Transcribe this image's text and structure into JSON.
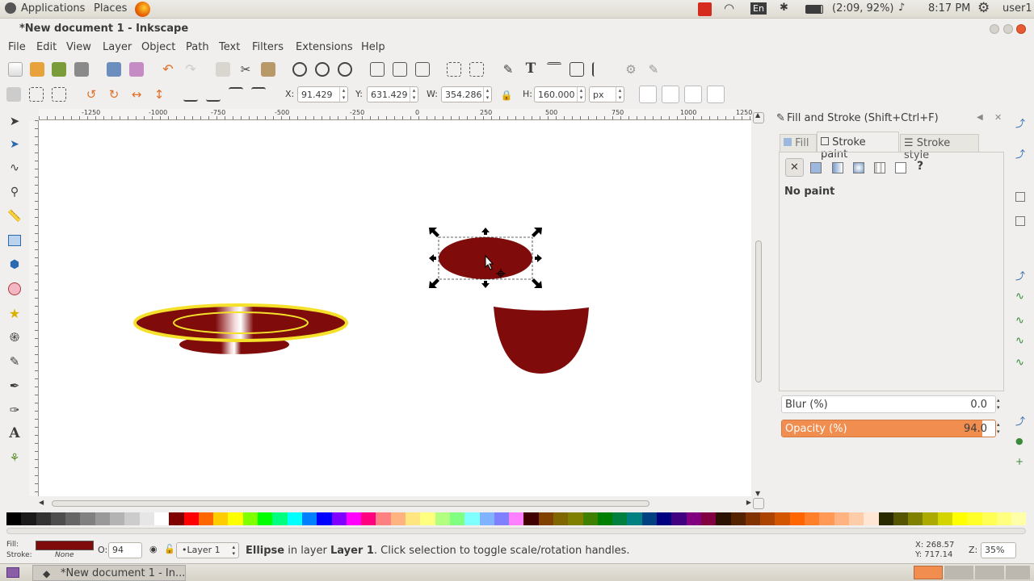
{
  "top_panel": {
    "applications": "Applications",
    "places": "Places",
    "keyboard": "En",
    "battery": "(2:09, 92%)",
    "time": "8:17 PM",
    "user": "user1"
  },
  "window": {
    "title": "*New document 1 - Inkscape"
  },
  "menu": [
    "File",
    "Edit",
    "View",
    "Layer",
    "Object",
    "Path",
    "Text",
    "Filters",
    "Extensions",
    "Help"
  ],
  "controls": {
    "x_label": "X:",
    "x_value": "91.429",
    "y_label": "Y:",
    "y_value": "631.429",
    "w_label": "W:",
    "w_value": "354.286",
    "h_label": "H:",
    "h_value": "160.000",
    "unit": "px"
  },
  "ruler": {
    "ticks": [
      "-1250",
      "-1000",
      "-750",
      "-500",
      "-250",
      "0",
      "250",
      "500",
      "750",
      "1000",
      "1250"
    ]
  },
  "dock": {
    "title": "Fill and Stroke (Shift+Ctrl+F)",
    "tabs": [
      "Fill",
      "Stroke paint",
      "Stroke style"
    ],
    "paint_status": "No paint",
    "blur_label": "Blur (%)",
    "blur_value": "0.0",
    "opacity_label": "Opacity (%)",
    "opacity_value": "94.0",
    "opacity_fraction": 0.94
  },
  "status": {
    "fill_label": "Fill:",
    "stroke_label": "Stroke:",
    "stroke_value": "None",
    "opacity_label": "O:",
    "opacity_value": "94",
    "layer": "•Layer 1",
    "message_bold": "Ellipse",
    "message_mid": " in layer ",
    "message_layer": "Layer 1",
    "message_tail": ". Click selection to toggle scale/rotation handles.",
    "cursor_x": "X: 268.57",
    "cursor_y": "Y: 717.14",
    "zoom_label": "Z:",
    "zoom": "35%"
  },
  "taskbar": {
    "window_label": "*New document 1 - In..."
  },
  "colors": {
    "selected_fill": "#7f0b0b",
    "accent_orange": "#f08d4f",
    "plate_yellow": "#f5e12a"
  }
}
